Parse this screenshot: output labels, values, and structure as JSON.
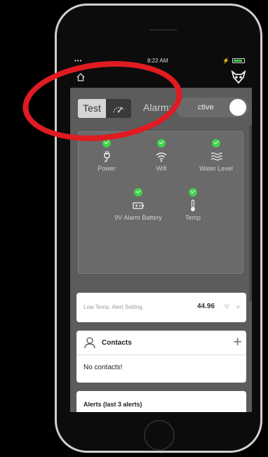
{
  "status_bar": {
    "signal": "•••",
    "time": "8:22 AM",
    "charge": "⚡"
  },
  "nav": {
    "home_icon": "home-icon",
    "logo_icon": "owl-logo-icon"
  },
  "controls": {
    "test_label": "Test",
    "gauge_icon": "gauge-icon",
    "alarm_label": "Alarm:",
    "alarm_state": "ctive"
  },
  "sensors": [
    {
      "label": "Power",
      "icon": "power-plug-icon",
      "status": "ok"
    },
    {
      "label": "Wifi",
      "icon": "wifi-icon",
      "status": "ok"
    },
    {
      "label": "Water Level",
      "icon": "water-level-icon",
      "status": "ok"
    },
    {
      "label": "9V Alarm Battery",
      "icon": "battery-icon",
      "status": "ok"
    },
    {
      "label": "Temp",
      "icon": "thermometer-icon",
      "status": "ok"
    }
  ],
  "temp_alert": {
    "label": "Low Temp. Alert Setting",
    "value": "44.96",
    "unit": "°F",
    "more": "≡"
  },
  "contacts": {
    "title": "Contacts",
    "add": "+",
    "empty": "No contacts!"
  },
  "alerts": {
    "title": "Alerts (last 3 alerts)"
  },
  "colors": {
    "accent_ok": "#3fd14a",
    "annotation": "#e01b22",
    "app_background": "#5c5c5c",
    "navbar": "#0c0c0c"
  }
}
